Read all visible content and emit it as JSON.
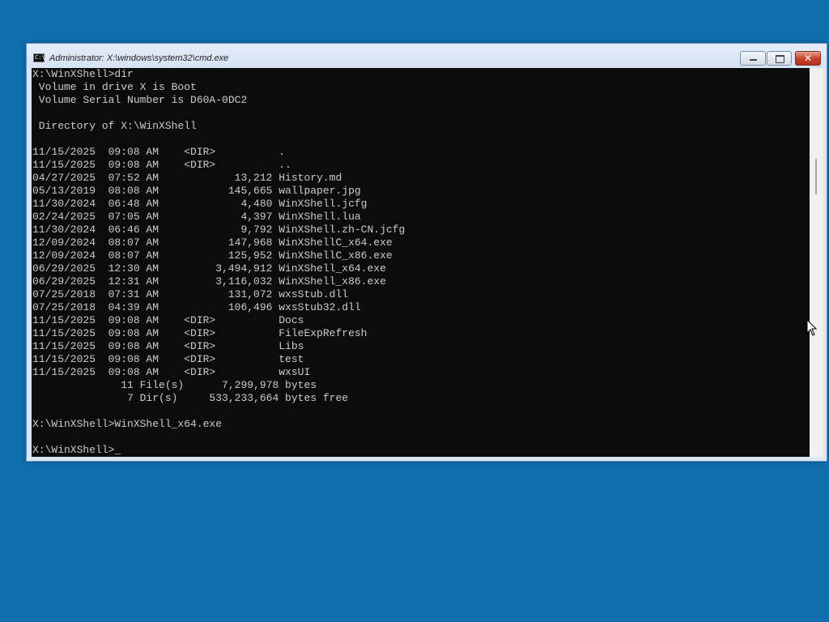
{
  "window": {
    "title": "Administrator: X:\\windows\\system32\\cmd.exe",
    "icon_text": "C:\\"
  },
  "console": {
    "lines": [
      "X:\\WinXShell>dir",
      " Volume in drive X is Boot",
      " Volume Serial Number is D60A-0DC2",
      "",
      " Directory of X:\\WinXShell",
      "",
      "11/15/2025  09:08 AM    <DIR>          .",
      "11/15/2025  09:08 AM    <DIR>          ..",
      "04/27/2025  07:52 AM            13,212 History.md",
      "05/13/2019  08:08 AM           145,665 wallpaper.jpg",
      "11/30/2024  06:48 AM             4,480 WinXShell.jcfg",
      "02/24/2025  07:05 AM             4,397 WinXShell.lua",
      "11/30/2024  06:46 AM             9,792 WinXShell.zh-CN.jcfg",
      "12/09/2024  08:07 AM           147,968 WinXShellC_x64.exe",
      "12/09/2024  08:07 AM           125,952 WinXShellC_x86.exe",
      "06/29/2025  12:30 AM         3,494,912 WinXShell_x64.exe",
      "06/29/2025  12:31 AM         3,116,032 WinXShell_x86.exe",
      "07/25/2018  07:31 AM           131,072 wxsStub.dll",
      "07/25/2018  04:39 AM           106,496 wxsStub32.dll",
      "11/15/2025  09:08 AM    <DIR>          Docs",
      "11/15/2025  09:08 AM    <DIR>          FileExpRefresh",
      "11/15/2025  09:08 AM    <DIR>          Libs",
      "11/15/2025  09:08 AM    <DIR>          test",
      "11/15/2025  09:08 AM    <DIR>          wxsUI",
      "              11 File(s)      7,299,978 bytes",
      "               7 Dir(s)     533,233,664 bytes free",
      "",
      "X:\\WinXShell>WinXShell_x64.exe",
      ""
    ],
    "prompt": "X:\\WinXShell>",
    "cursor": "_"
  },
  "colors": {
    "desktop": "#0f6eae",
    "console_bg": "#0c0c0c",
    "console_fg": "#cccccc",
    "close_button": "#c9462f"
  },
  "icons": {
    "app": "console-icon",
    "minimize": "minimize-icon",
    "maximize": "maximize-icon",
    "close": "close-icon",
    "pointer": "mouse-pointer-icon"
  }
}
